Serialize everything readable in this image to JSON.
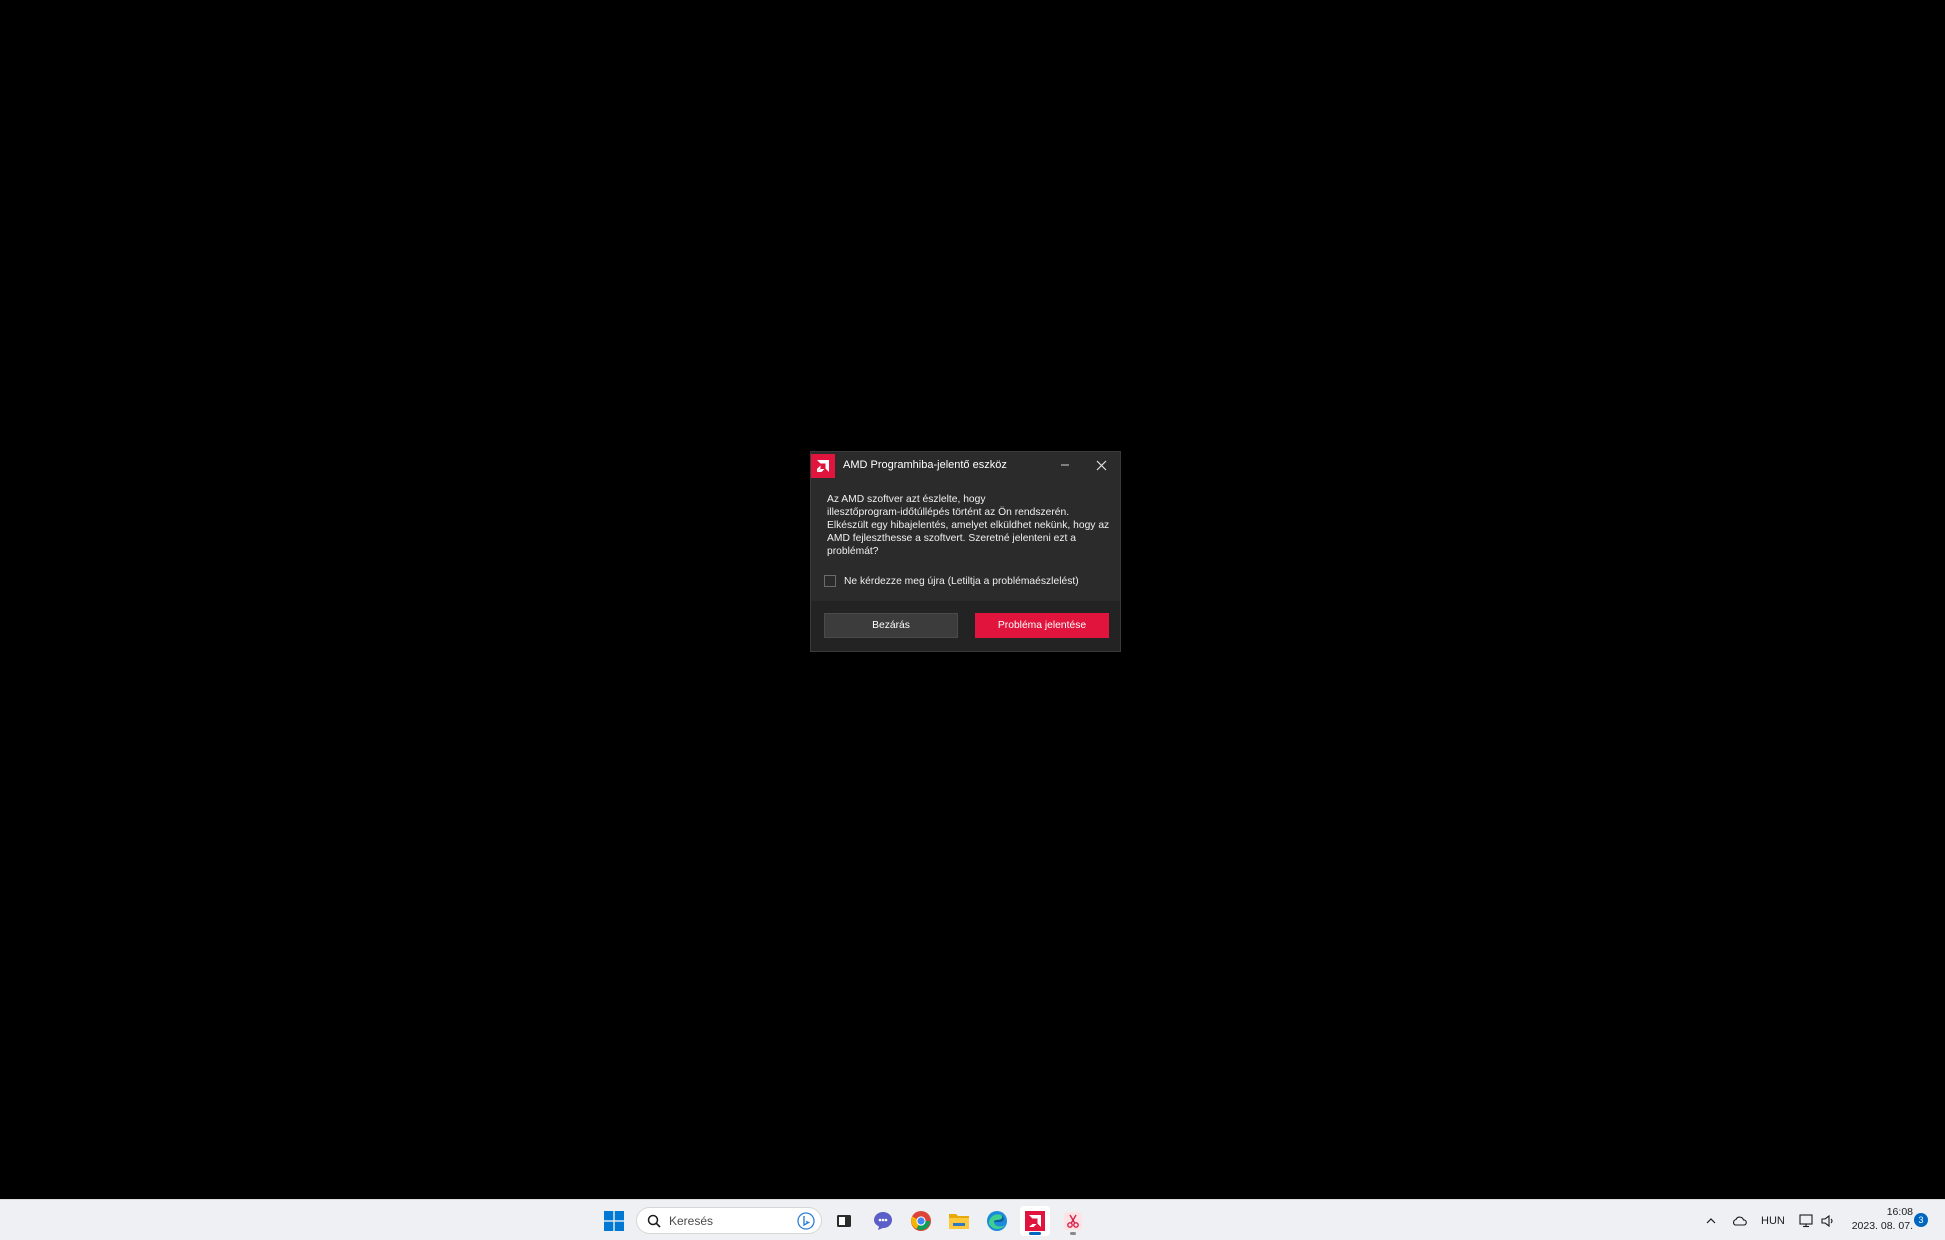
{
  "dialog": {
    "title": "AMD Programhiba-jelentő eszköz",
    "message_lines": [
      "Az AMD szoftver azt észlelte, hogy",
      "illesztőprogram-időtúllépés történt az Ön rendszerén.",
      "Elkészült egy hibajelentés, amelyet elküldhet nekünk, hogy az",
      "AMD fejleszthesse a szoftvert. Szeretné jelenteni ezt a",
      "problémát?"
    ],
    "checkbox_label": "Ne kérdezze meg újra (Letiltja a problémaészlelést)",
    "checkbox_checked": false,
    "close_button": "Bezárás",
    "report_button": "Probléma jelentése",
    "accent_color": "#e0143c"
  },
  "taskbar": {
    "search_placeholder": "Keresés",
    "apps": [
      {
        "name": "start",
        "icon": "windows-logo-icon"
      },
      {
        "name": "search",
        "icon": "search-icon"
      },
      {
        "name": "terminal",
        "icon": "terminal-icon"
      },
      {
        "name": "teams",
        "icon": "teams-chat-icon"
      },
      {
        "name": "chrome",
        "icon": "chrome-icon"
      },
      {
        "name": "file-explorer",
        "icon": "folder-icon"
      },
      {
        "name": "edge",
        "icon": "edge-icon"
      },
      {
        "name": "amd-bug-report",
        "icon": "amd-logo-icon"
      },
      {
        "name": "snipping-tool",
        "icon": "snipping-tool-icon"
      }
    ],
    "tray": {
      "language": "HUN",
      "time": "16:08",
      "date": "2023. 08. 07.",
      "notification_count": "3"
    }
  }
}
